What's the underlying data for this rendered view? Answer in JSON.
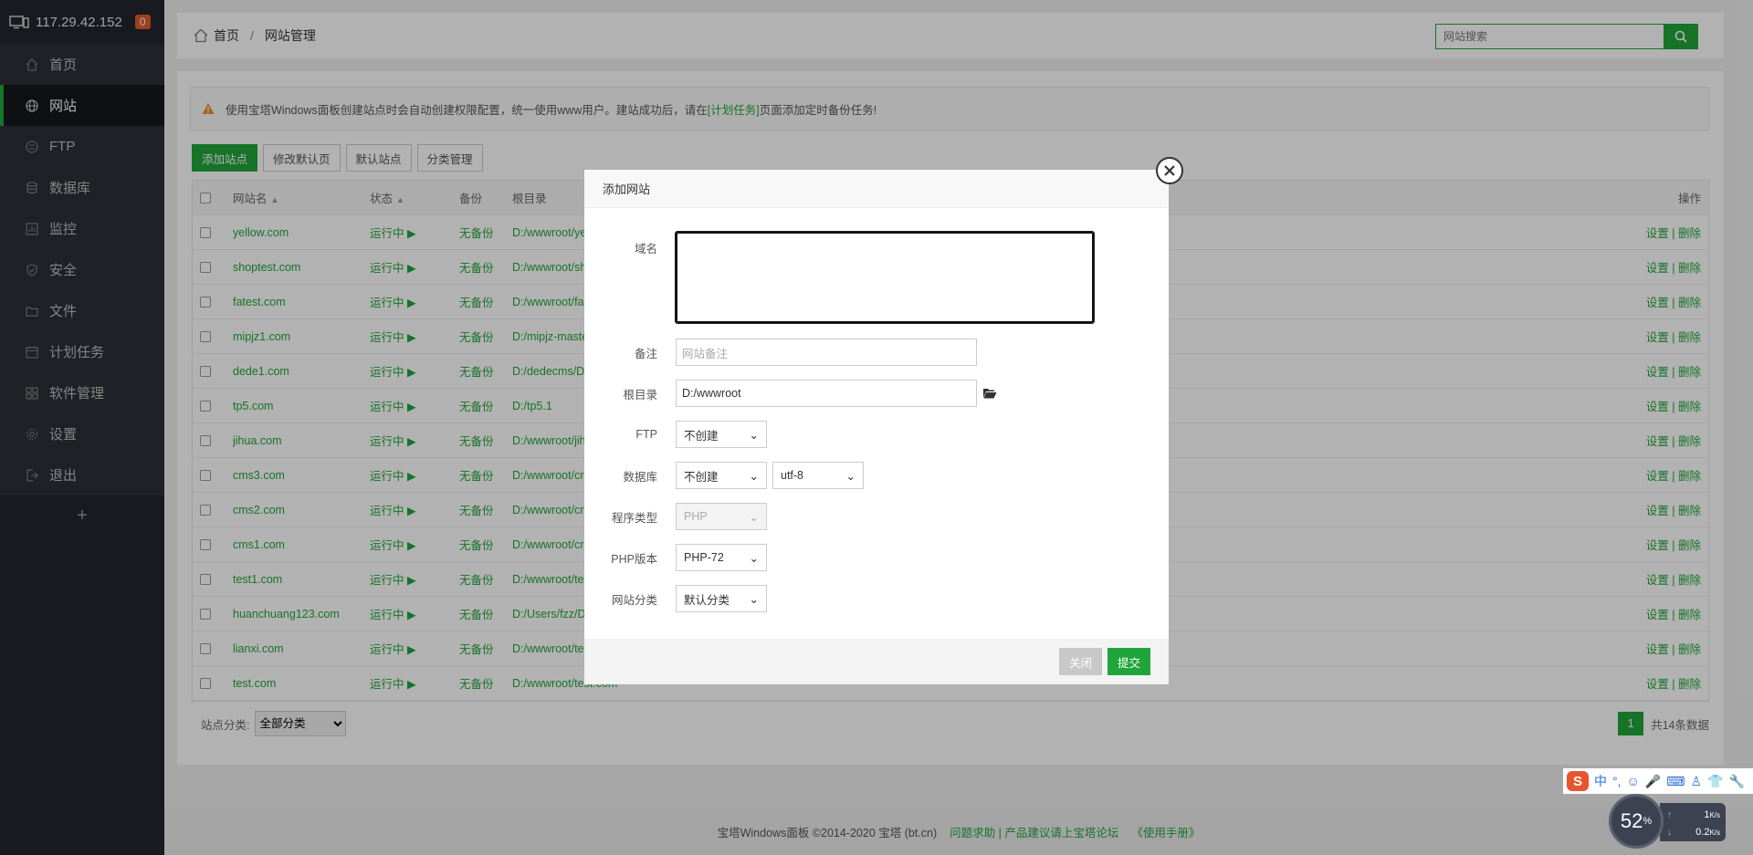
{
  "sidebar": {
    "server_ip": "117.29.42.152",
    "badge_count": "0",
    "items": [
      {
        "label": "首页",
        "icon": "home-icon"
      },
      {
        "label": "网站",
        "icon": "globe-icon",
        "active": true
      },
      {
        "label": "FTP",
        "icon": "ftp-icon"
      },
      {
        "label": "数据库",
        "icon": "database-icon"
      },
      {
        "label": "监控",
        "icon": "monitor-icon"
      },
      {
        "label": "安全",
        "icon": "shield-icon"
      },
      {
        "label": "文件",
        "icon": "folder-icon"
      },
      {
        "label": "计划任务",
        "icon": "calendar-icon"
      },
      {
        "label": "软件管理",
        "icon": "grid-icon"
      },
      {
        "label": "设置",
        "icon": "gear-icon"
      },
      {
        "label": "退出",
        "icon": "logout-icon"
      }
    ],
    "add_label": "+"
  },
  "header": {
    "breadcrumb_home": "首页",
    "breadcrumb_sep": "/",
    "breadcrumb_current": "网站管理",
    "search_placeholder": "网站搜索"
  },
  "notice": {
    "text_before": "使用宝塔Windows面板创建站点时会自动创建权限配置，统一使用www用户。建站成功后，请在",
    "link": "[计划任务]",
    "text_after": "页面添加定时备份任务!"
  },
  "toolbar": {
    "add_site": "添加站点",
    "modify_default_page": "修改默认页",
    "default_site": "默认站点",
    "category_manage": "分类管理"
  },
  "table": {
    "headers": {
      "name": "网站名",
      "status": "状态",
      "backup": "备份",
      "root": "根目录",
      "op": "操作"
    },
    "rows": [
      {
        "name": "yellow.com",
        "status": "运行中 ▶",
        "backup": "无备份",
        "root": "D:/wwwroot/ye",
        "op": "设置 | 删除"
      },
      {
        "name": "shoptest.com",
        "status": "运行中 ▶",
        "backup": "无备份",
        "root": "D:/wwwroot/sh",
        "op": "设置 | 删除"
      },
      {
        "name": "fatest.com",
        "status": "运行中 ▶",
        "backup": "无备份",
        "root": "D:/wwwroot/fa",
        "op": "设置 | 删除"
      },
      {
        "name": "mipjz1.com",
        "status": "运行中 ▶",
        "backup": "无备份",
        "root": "D:/mipjz-maste",
        "op": "设置 | 删除"
      },
      {
        "name": "dede1.com",
        "status": "运行中 ▶",
        "backup": "无备份",
        "root": "D:/dedecms/D",
        "op": "设置 | 删除"
      },
      {
        "name": "tp5.com",
        "status": "运行中 ▶",
        "backup": "无备份",
        "root": "D:/tp5.1",
        "op": "设置 | 删除"
      },
      {
        "name": "jihua.com",
        "status": "运行中 ▶",
        "backup": "无备份",
        "root": "D:/wwwroot/jih",
        "op": "设置 | 删除"
      },
      {
        "name": "cms3.com",
        "status": "运行中 ▶",
        "backup": "无备份",
        "root": "D:/wwwroot/cr",
        "op": "设置 | 删除"
      },
      {
        "name": "cms2.com",
        "status": "运行中 ▶",
        "backup": "无备份",
        "root": "D:/wwwroot/cr",
        "op": "设置 | 删除"
      },
      {
        "name": "cms1.com",
        "status": "运行中 ▶",
        "backup": "无备份",
        "root": "D:/wwwroot/cr",
        "op": "设置 | 删除"
      },
      {
        "name": "test1.com",
        "status": "运行中 ▶",
        "backup": "无备份",
        "root": "D:/wwwroot/te",
        "op": "设置 | 删除"
      },
      {
        "name": "huanchuang123.com",
        "status": "运行中 ▶",
        "backup": "无备份",
        "root": "D:/Users/fzz/D",
        "op": "设置 | 删除"
      },
      {
        "name": "lianxi.com",
        "status": "运行中 ▶",
        "backup": "无备份",
        "root": "D:/wwwroot/te",
        "op": "设置 | 删除"
      },
      {
        "name": "test.com",
        "status": "运行中 ▶",
        "backup": "无备份",
        "root": "D:/wwwroot/test.com",
        "op": "设置 | 删除"
      }
    ],
    "category_label": "站点分类:",
    "category_value": "全部分类",
    "page": "1",
    "total": "共14条数据"
  },
  "modal": {
    "title": "添加网站",
    "domain_label": "域名",
    "domain_value": "",
    "remark_label": "备注",
    "remark_placeholder": "网站备注",
    "root_label": "根目录",
    "root_value": "D:/wwwroot",
    "ftp_label": "FTP",
    "ftp_value": "不创建",
    "db_label": "数据库",
    "db_value": "不创建",
    "charset_value": "utf-8",
    "program_label": "程序类型",
    "program_value": "PHP",
    "php_label": "PHP版本",
    "php_value": "PHP-72",
    "category_label": "网站分类",
    "category_value": "默认分类",
    "close_btn": "关闭",
    "submit_btn": "提交"
  },
  "footer": {
    "copyright": "宝塔Windows面板 ©2014-2020 宝塔 (bt.cn)",
    "help": "问题求助 | 产品建议请上宝塔论坛",
    "manual": "《使用手册》"
  },
  "tray": {
    "ime_lang": "中",
    "cpu_percent": "52",
    "cpu_unit": "%",
    "up_speed": "1",
    "up_unit": "K/s",
    "down_speed": "0.2",
    "down_unit": "K/s"
  },
  "colors": {
    "accent": "#20a53a",
    "sidebar_bg": "#23262e",
    "badge": "#e05d2a"
  }
}
